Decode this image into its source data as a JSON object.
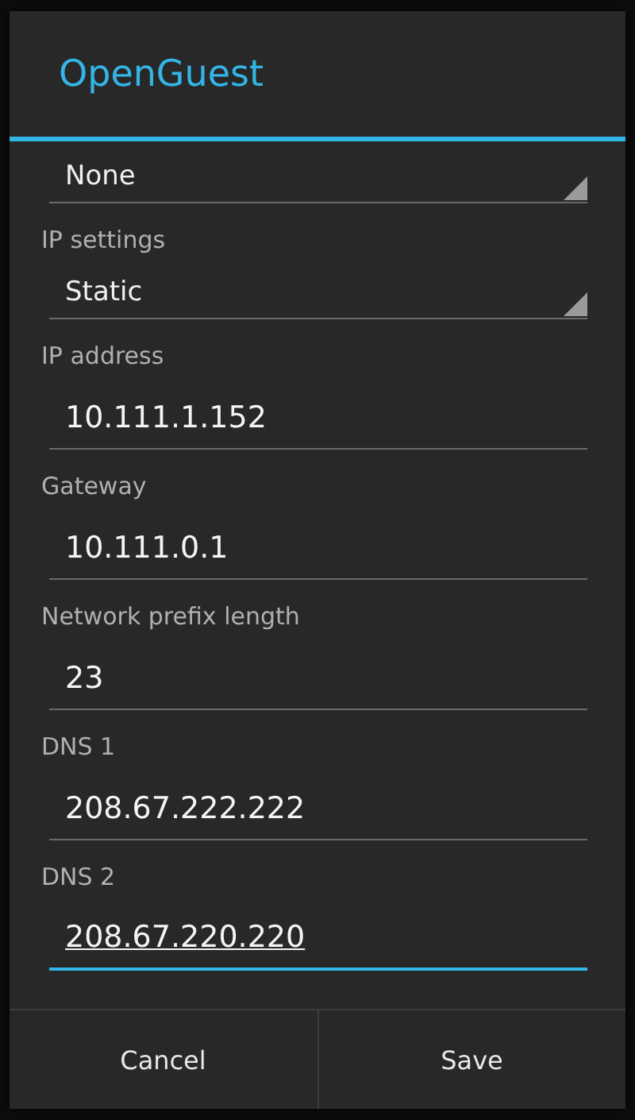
{
  "dialog": {
    "title": "OpenGuest"
  },
  "rows": [
    {
      "kind": "spinner",
      "value": "None"
    },
    {
      "kind": "spinner",
      "label": "IP settings",
      "value": "Static"
    },
    {
      "kind": "field",
      "label": "IP address",
      "value": "10.111.1.152",
      "focused": false
    },
    {
      "kind": "field",
      "label": "Gateway",
      "value": "10.111.0.1",
      "focused": false
    },
    {
      "kind": "field",
      "label": "Network prefix length",
      "value": "23",
      "focused": false
    },
    {
      "kind": "field",
      "label": "DNS 1",
      "value": "208.67.222.222",
      "focused": false
    },
    {
      "kind": "field",
      "label": "DNS 2",
      "value": "208.67.220.220",
      "focused": true
    }
  ],
  "buttons": [
    "Cancel",
    "Save"
  ]
}
